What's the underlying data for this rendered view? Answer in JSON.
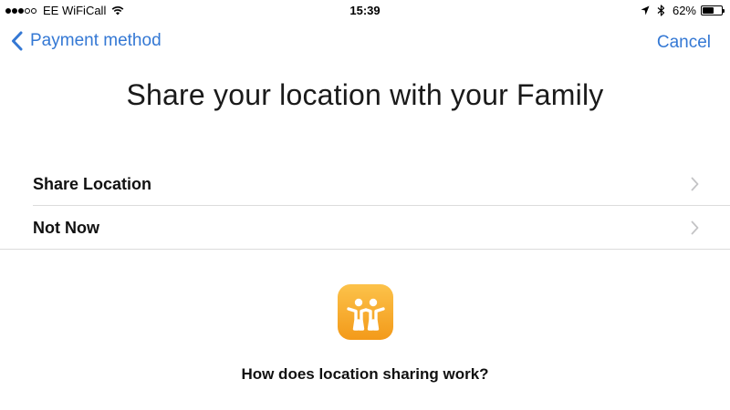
{
  "status_bar": {
    "carrier": "EE WiFiCall",
    "time": "15:39",
    "battery_percent_label": "62%",
    "battery_level": 0.62,
    "signal_bars_filled": 3,
    "signal_bars_total": 5
  },
  "nav": {
    "back_label": "Payment method",
    "cancel_label": "Cancel"
  },
  "title": "Share your location with your Family",
  "options": [
    {
      "label": "Share Location",
      "icon": "chevron-right-icon"
    },
    {
      "label": "Not Now",
      "icon": "chevron-right-icon"
    }
  ],
  "info": {
    "app_icon": "find-my-friends-icon",
    "link_label": "How does location sharing work?"
  },
  "colors": {
    "accent": "#3478d4",
    "app_icon_top": "#fcc24a",
    "app_icon_bottom": "#f39a1a"
  }
}
